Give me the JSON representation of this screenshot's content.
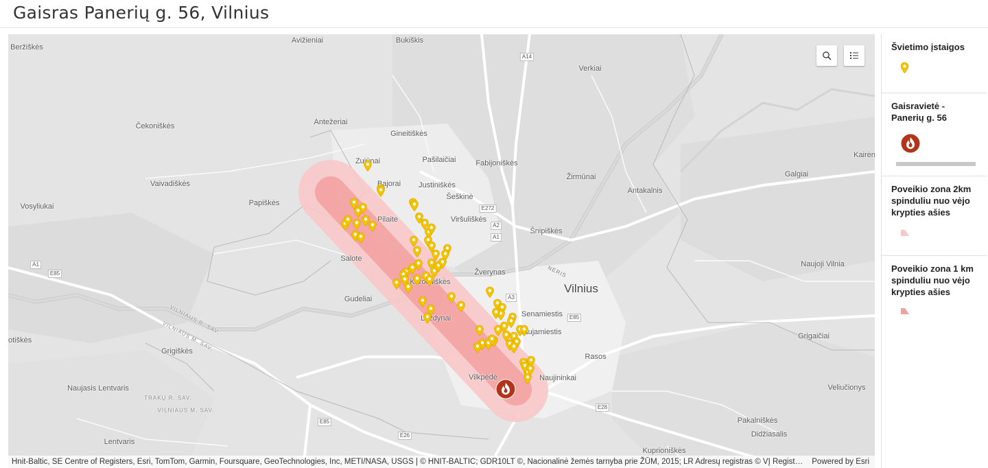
{
  "header": {
    "title": "Gaisras Panerių g. 56, Vilnius"
  },
  "map": {
    "labels": [
      {
        "text": "Beržiškės",
        "type": "place"
      },
      {
        "text": "Avižieniai",
        "type": "place"
      },
      {
        "text": "Bukiškis",
        "type": "place"
      },
      {
        "text": "Verkiai",
        "type": "place"
      },
      {
        "text": "Čekoniškės",
        "type": "place"
      },
      {
        "text": "Antežeriai",
        "type": "place"
      },
      {
        "text": "Gineitiškės",
        "type": "place"
      },
      {
        "text": "Zujūnai",
        "type": "place"
      },
      {
        "text": "Pašilaičiai",
        "type": "place"
      },
      {
        "text": "Fabijoniškės",
        "type": "place"
      },
      {
        "text": "Kairėn",
        "type": "place"
      },
      {
        "text": "Galgiai",
        "type": "place"
      },
      {
        "text": "Vaivadiškės",
        "type": "place"
      },
      {
        "text": "Bajorai",
        "type": "place"
      },
      {
        "text": "Justiniškės",
        "type": "place"
      },
      {
        "text": "Žirmūnai",
        "type": "place"
      },
      {
        "text": "Antakalnis",
        "type": "place"
      },
      {
        "text": "Šeškinė",
        "type": "place"
      },
      {
        "text": "Vosyliukai",
        "type": "place"
      },
      {
        "text": "Papiškės",
        "type": "place"
      },
      {
        "text": "Pilaite",
        "type": "place"
      },
      {
        "text": "Viršuliškės",
        "type": "place"
      },
      {
        "text": "Šnipiškės",
        "type": "place"
      },
      {
        "text": "Salote",
        "type": "place"
      },
      {
        "text": "Naujoji Vilnia",
        "type": "place"
      },
      {
        "text": "Žverynas",
        "type": "place"
      },
      {
        "text": "Vilnius",
        "type": "city"
      },
      {
        "text": "Karoliniškės",
        "type": "place"
      },
      {
        "text": "Gudeliai",
        "type": "place"
      },
      {
        "text": "Senamiestis",
        "type": "place"
      },
      {
        "text": "Lazdynai",
        "type": "place"
      },
      {
        "text": "Naujamiestis",
        "type": "place"
      },
      {
        "text": "otiškės",
        "type": "place"
      },
      {
        "text": "Grigiškės",
        "type": "place"
      },
      {
        "text": "Grigaičiai",
        "type": "place"
      },
      {
        "text": "Rasos",
        "type": "place"
      },
      {
        "text": "Vilkpėdė",
        "type": "place"
      },
      {
        "text": "Naujininkai",
        "type": "place"
      },
      {
        "text": "Naujasis Lentvaris",
        "type": "place"
      },
      {
        "text": "Veliučionys",
        "type": "place"
      },
      {
        "text": "Pakalniškės",
        "type": "place"
      },
      {
        "text": "Didžiasalis",
        "type": "place"
      },
      {
        "text": "Lentvaris",
        "type": "place"
      },
      {
        "text": "Kuprioniškės",
        "type": "place"
      },
      {
        "text": "NERIS",
        "type": "river"
      },
      {
        "text": "VILNIAUS R. SAV.",
        "type": "sav"
      },
      {
        "text": "VILNIAUS M. SAV.",
        "type": "sav"
      },
      {
        "text": "TRAKŲ R. SAV.",
        "type": "sav"
      },
      {
        "text": "VILNIAUS M. SAV.",
        "type": "sav"
      }
    ],
    "shields": [
      "A14",
      "E272",
      "A2",
      "A1",
      "A3",
      "E85",
      "A1",
      "E85",
      "E28",
      "E26",
      "E85"
    ],
    "search_icon": "search-icon",
    "legend_toggle_icon": "list-icon",
    "fire_icon": "fire-icon",
    "pin_color": "#f5c400",
    "buffer_colors": {
      "outer": "#f7c2c2",
      "inner": "#f29a9a"
    },
    "fire_color": "#b2341a"
  },
  "attribution": {
    "text": "Hnit-Baltic, SE Centre of Registers, Esri, TomTom, Garmin, Foursquare, GeoTechnologies, Inc, METI/NASA, USGS | © HNIT-BALTIC; GDR10LT ©, Nacionalinė žemės tarnyba prie ŽŪM, 2015; LR Adresų registras © VĮ Registrų centras",
    "powered": "Powered by Esri"
  },
  "legend": {
    "items": [
      {
        "title": "Švietimo įstaigos",
        "symbol": "pin"
      },
      {
        "title": "Gaisravietė - Panerių g. 56",
        "symbol": "fire"
      },
      {
        "title": "Poveikio zona 2km spinduliu nuo vėjo krypties ašies",
        "symbol": "swatch"
      },
      {
        "title": "Poveikio zona 1 km spinduliu nuo vėjo krypties ašies",
        "symbol": "swatch"
      }
    ]
  }
}
